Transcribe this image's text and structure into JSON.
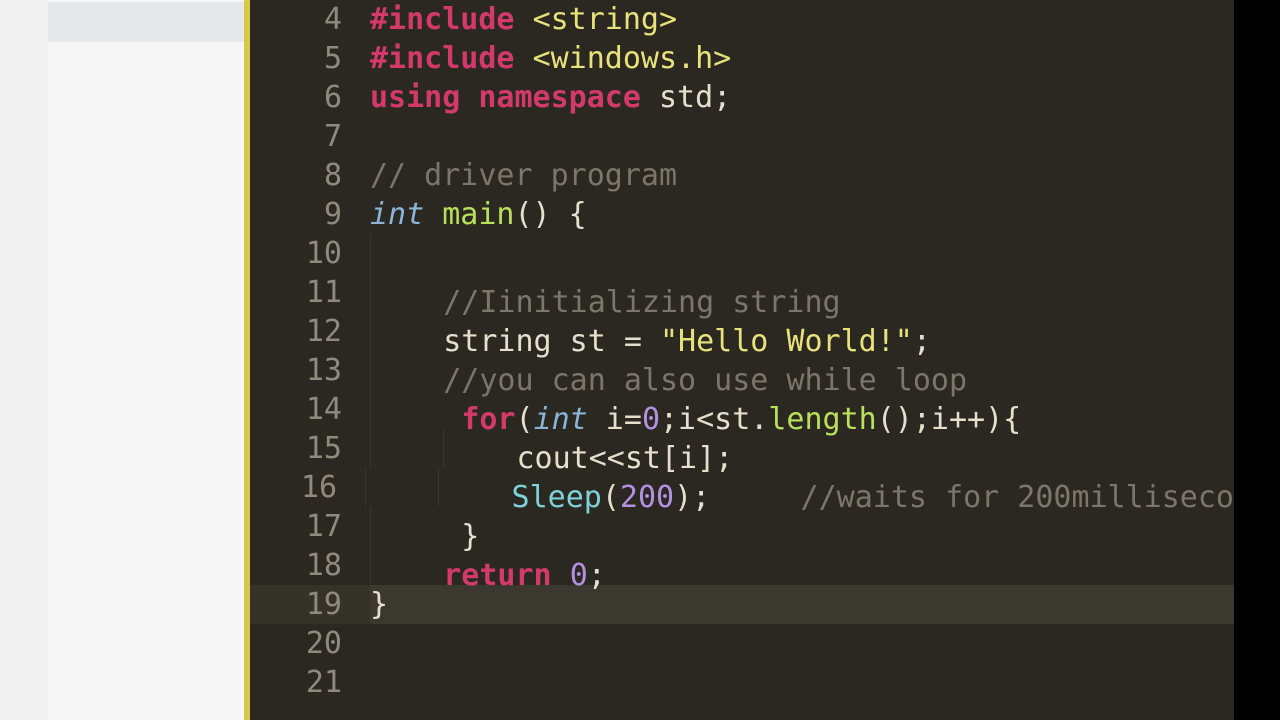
{
  "editor": {
    "first_visible_line": 4,
    "cursor_line": 19,
    "lines": [
      {
        "n": 4,
        "indent": 0,
        "tokens": [
          {
            "c": "tok-kw",
            "t": "#include"
          },
          {
            "c": "tok-pl",
            "t": " "
          },
          {
            "c": "tok-str",
            "t": "<string>"
          }
        ]
      },
      {
        "n": 5,
        "indent": 0,
        "tokens": [
          {
            "c": "tok-kw",
            "t": "#include"
          },
          {
            "c": "tok-pl",
            "t": " "
          },
          {
            "c": "tok-str",
            "t": "<windows.h>"
          }
        ]
      },
      {
        "n": 6,
        "indent": 0,
        "tokens": [
          {
            "c": "tok-kw",
            "t": "using"
          },
          {
            "c": "tok-pl",
            "t": " "
          },
          {
            "c": "tok-kw",
            "t": "namespace"
          },
          {
            "c": "tok-pl",
            "t": " std;"
          }
        ]
      },
      {
        "n": 7,
        "indent": 0,
        "tokens": []
      },
      {
        "n": 8,
        "indent": 0,
        "tokens": [
          {
            "c": "tok-cmt",
            "t": "// driver program"
          }
        ]
      },
      {
        "n": 9,
        "indent": 0,
        "tokens": [
          {
            "c": "tok-type",
            "t": "int"
          },
          {
            "c": "tok-pl",
            "t": " "
          },
          {
            "c": "tok-fn",
            "t": "main"
          },
          {
            "c": "tok-pl",
            "t": "() {"
          }
        ]
      },
      {
        "n": 10,
        "indent": 1,
        "tokens": []
      },
      {
        "n": 11,
        "indent": 1,
        "tokens": [
          {
            "c": "tok-cmt",
            "t": "//Iinitializing string"
          }
        ]
      },
      {
        "n": 12,
        "indent": 1,
        "tokens": [
          {
            "c": "tok-pl",
            "t": "string st = "
          },
          {
            "c": "tok-str",
            "t": "\"Hello World!\""
          },
          {
            "c": "tok-pl",
            "t": ";"
          }
        ]
      },
      {
        "n": 13,
        "indent": 1,
        "tokens": [
          {
            "c": "tok-cmt",
            "t": "//you can also use while loop"
          }
        ]
      },
      {
        "n": 14,
        "indent": 1,
        "tokens": [
          {
            "c": "tok-pl",
            "t": " "
          },
          {
            "c": "tok-kw",
            "t": "for"
          },
          {
            "c": "tok-pl",
            "t": "("
          },
          {
            "c": "tok-type",
            "t": "int"
          },
          {
            "c": "tok-pl",
            "t": " i="
          },
          {
            "c": "tok-num",
            "t": "0"
          },
          {
            "c": "tok-pl",
            "t": ";i<st."
          },
          {
            "c": "tok-fn",
            "t": "length"
          },
          {
            "c": "tok-pl",
            "t": "();i++){"
          }
        ]
      },
      {
        "n": 15,
        "indent": 2,
        "tokens": [
          {
            "c": "tok-pl",
            "t": "cout<<st[i];"
          }
        ]
      },
      {
        "n": 16,
        "indent": 2,
        "tokens": [
          {
            "c": "tok-cls",
            "t": "Sleep"
          },
          {
            "c": "tok-pl",
            "t": "("
          },
          {
            "c": "tok-num",
            "t": "200"
          },
          {
            "c": "tok-pl",
            "t": ");     "
          },
          {
            "c": "tok-cmt",
            "t": "//waits for 200milliseco"
          }
        ]
      },
      {
        "n": 17,
        "indent": 1,
        "tokens": [
          {
            "c": "tok-pl",
            "t": " }"
          }
        ]
      },
      {
        "n": 18,
        "indent": 1,
        "tokens": [
          {
            "c": "tok-kw",
            "t": "return"
          },
          {
            "c": "tok-pl",
            "t": " "
          },
          {
            "c": "tok-num",
            "t": "0"
          },
          {
            "c": "tok-pl",
            "t": ";"
          }
        ]
      },
      {
        "n": 19,
        "indent": 0,
        "tokens": [
          {
            "c": "tok-pl",
            "t": "}"
          }
        ]
      },
      {
        "n": 20,
        "indent": 0,
        "tokens": []
      },
      {
        "n": 21,
        "indent": 0,
        "tokens": []
      }
    ]
  },
  "colors": {
    "background": "#2b2822",
    "gutter_text": "#8f8a7c",
    "change_bar": "#d8c84a",
    "keyword": "#d33a6b",
    "type": "#8ab4d8",
    "function": "#b8e05a",
    "class": "#7fd1d8",
    "string": "#e8e27a",
    "number": "#b490e0",
    "comment": "#7b766a",
    "plain": "#e6dfce"
  }
}
